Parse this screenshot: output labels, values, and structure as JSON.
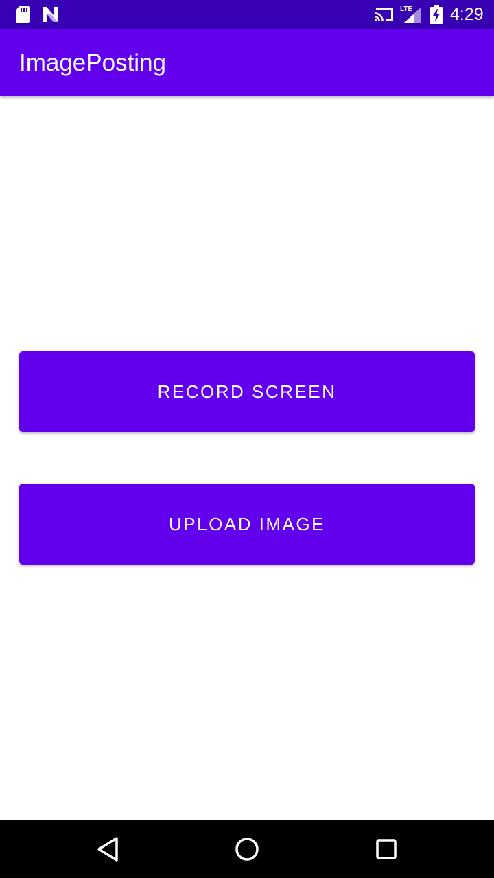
{
  "status_bar": {
    "time": "4:29",
    "network_label": "LTE",
    "icons": [
      "sd-card-icon",
      "n-notification-icon",
      "cast-icon",
      "lte-signal-icon",
      "battery-charging-icon"
    ]
  },
  "app_bar": {
    "title": "ImagePosting"
  },
  "main": {
    "record_button_label": "RECORD SCREEN",
    "upload_button_label": "UPLOAD IMAGE"
  },
  "nav_bar": {
    "icons": [
      "back-icon",
      "home-icon",
      "recents-icon"
    ]
  },
  "colors": {
    "status_bar": "#3700b3",
    "primary": "#6200ee",
    "nav_bar": "#000000",
    "background": "#ffffff",
    "on_primary": "#ffffff"
  }
}
